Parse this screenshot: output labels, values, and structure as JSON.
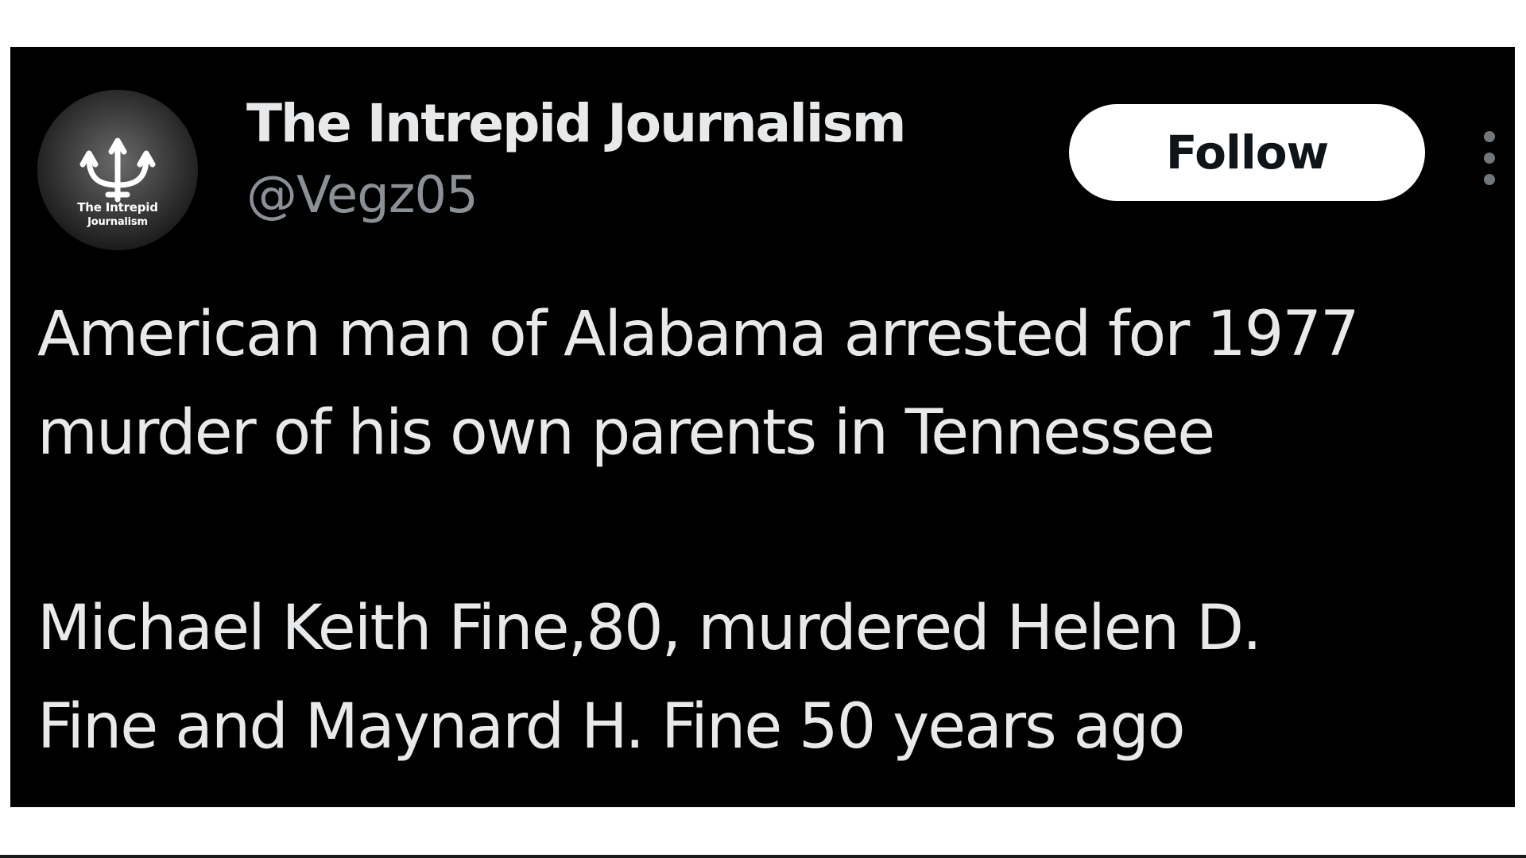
{
  "tweet": {
    "author": {
      "display_name": "The Intrepid Journalism",
      "handle": "@Vegz05",
      "avatar": {
        "icon": "trident-icon",
        "logo_text_line1": "The Intrepid",
        "logo_text_line2": "Journalism"
      }
    },
    "follow_label": "Follow",
    "more_icon": "more-vertical-icon",
    "text_lines": [
      "American man of Alabama arrested for 1977",
      "murder of his own parents in Tennessee",
      "Michael Keith Fine,80, murdered Helen D.",
      "Fine and Maynard H. Fine 50 years ago"
    ]
  },
  "colors": {
    "card_background": "#000000",
    "page_background": "#ffffff",
    "primary_text": "#e7e9ea",
    "secondary_text": "#8b9096",
    "follow_button_bg": "#ffffff",
    "follow_button_text": "#0f1419"
  }
}
